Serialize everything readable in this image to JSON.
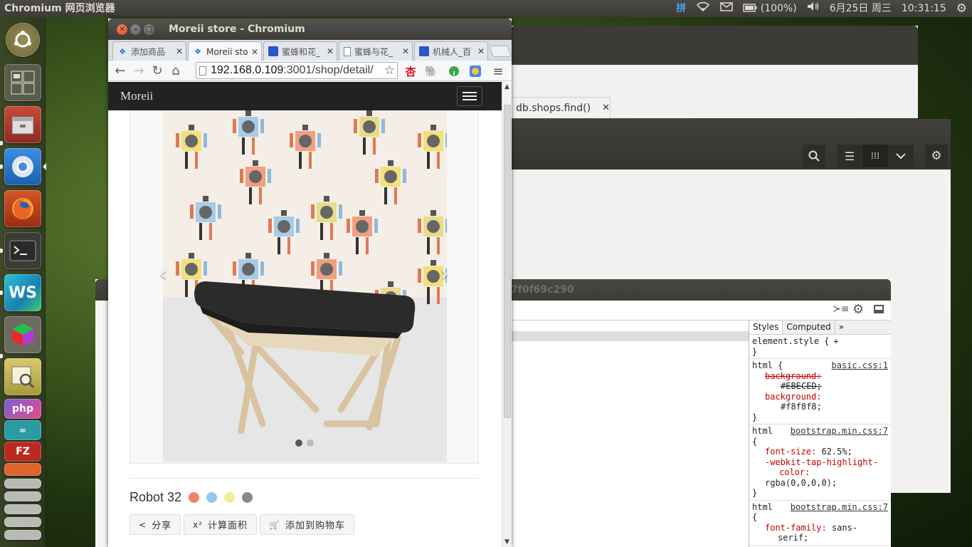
{
  "top_panel": {
    "app_title": "Chromium 网页浏览器",
    "ime": "拼",
    "battery": "(100%)",
    "date": "6月25日 周三",
    "time": "10:31:15"
  },
  "browser": {
    "window_title": "Moreii store - Chromium",
    "tabs": [
      {
        "label": "添加商品",
        "favicon": "blue-diamond-icon"
      },
      {
        "label": "Moreii sto",
        "favicon": "blue-diamond-icon"
      },
      {
        "label": "蜜蜂和花_",
        "favicon": "paw-icon"
      },
      {
        "label": "蜜蜂与花_",
        "favicon": "document-icon"
      },
      {
        "label": "机械人_百",
        "favicon": "paw-icon"
      }
    ],
    "url_host": "192.168.0.109",
    "url_rest": ":3001/shop/detail/"
  },
  "page": {
    "brand": "Moreii",
    "product_name": "Robot 32",
    "swatches": [
      "#f08462",
      "#94c6ea",
      "#f2ea9c",
      "#8a8a8a"
    ],
    "buttons": {
      "share": "分享",
      "area": "计算面积",
      "cart": "添加到购物车"
    },
    "area_icon": "x²"
  },
  "background": {
    "query_tab": "db.shops.find()",
    "devtools_title": "7f0f69c290",
    "styles_tabs": {
      "styles": "Styles",
      "computed": "Computed"
    },
    "css_rules": {
      "element_style": "element.style {",
      "html_sel": "html {",
      "basic_src": "basic.css:1",
      "bg_prop": "background:",
      "bg_old": "#EBECED;",
      "bg_new": "#f8f8f8;",
      "html_sel2": "html",
      "bootstrap_src": "bootstrap.min.css:7",
      "font_size": "font-size:",
      "font_size_val": "62.5%;",
      "tap": "-webkit-tap-highlight-",
      "tap2": "color:",
      "tap_val": "rgba(0,0,0,0);",
      "font_family": "font-family:",
      "font_family_val": "sans-",
      "font_family_val2": "serif;"
    }
  }
}
